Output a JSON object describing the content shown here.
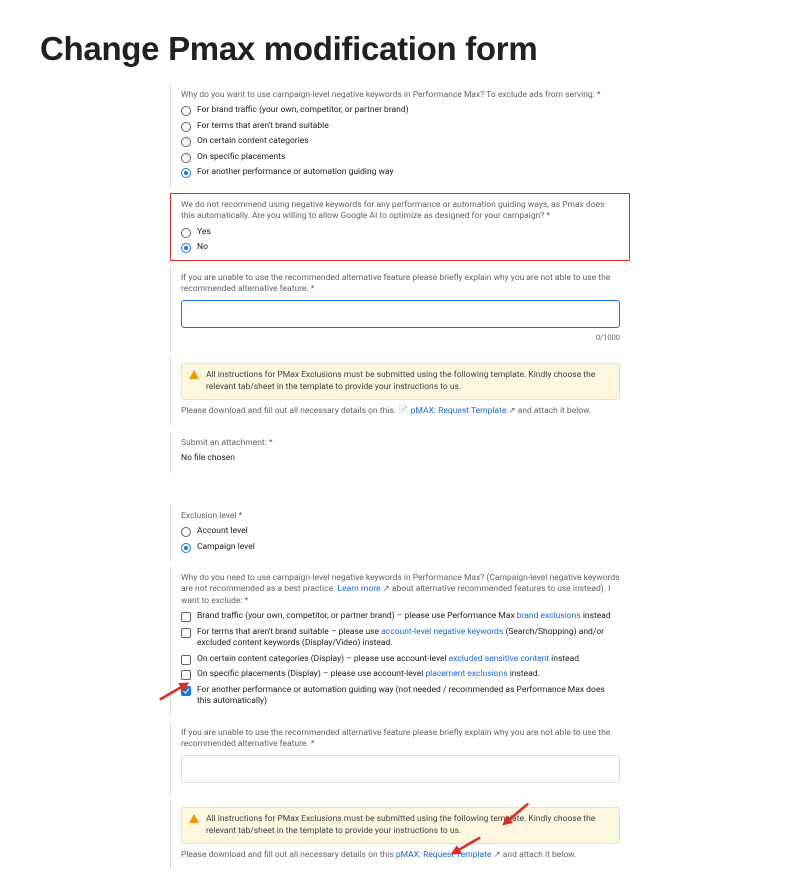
{
  "title": "Change Pmax modification form",
  "panel1": {
    "q1": {
      "text": "Why do you want to use campaign-level negative keywords in Performance Max? To exclude ads from serving: *",
      "opts": [
        "For brand traffic (your own, competitor, or partner brand)",
        "For terms that aren't brand suitable",
        "On certain content categories",
        "On specific placements",
        "For another performance or automation guiding way"
      ],
      "selected": 4
    },
    "warn": {
      "text": "We do not recommend using negative keywords for any performance or automation guiding ways, as Pmax does this automatically. Are you willing to allow Google AI to optimize as designed for your campaign? *",
      "opts": [
        "Yes",
        "No"
      ],
      "selected": 1
    },
    "explain": {
      "text": "If you are unable to use the recommended alternative feature please briefly explain why you are not able to use the recommended alternative feature. *",
      "counter": "0/1000"
    },
    "alert": "All instructions for PMax Exclusions must be submitted using the following template. Kindly choose the relevant tab/sheet in the template to provide your instructions to us.",
    "dl_pre": "Please download and fill out all necessary details on this. ",
    "dl_icon": "📄 ",
    "dl_link": "pMAX: Request Template",
    "dl_post": " ↗  and attach it below.",
    "submit_label": "Submit an attachment: *",
    "no_file": "No file chosen"
  },
  "panel2": {
    "excl": {
      "text": "Exclusion level *",
      "opts": [
        "Account level",
        "Campaign level"
      ],
      "selected": 1
    },
    "q2": {
      "pre": "Why do you need to use campaign-level negative keywords in Performance Max? (Campaign-level negative keywords are not recommended as a best practice. ",
      "learn": "Learn more",
      "post": " ↗  about alternative recommended features to use instead). I want to exclude: *",
      "items": [
        {
          "pre": "Brand traffic (your own, competitor, or partner brand) – please use Performance Max ",
          "link": "brand exclusions",
          "post": " instead"
        },
        {
          "pre": "For terms that aren't brand suitable – please use ",
          "link": "account-level negative keywords",
          "post": " (Search/Shopping) and/or excluded content keywords (Display/Video) instead."
        },
        {
          "pre": "On certain content categories (Display) – please use account-level ",
          "link": "excluded sensitive content",
          "post": " instead"
        },
        {
          "pre": "On specific placements (Display) – please use account-level ",
          "link": "placement exclusions",
          "post": " instead."
        },
        {
          "pre": "For another performance or automation guiding way (not needed / recommended as Performance Max does this automatically)",
          "link": "",
          "post": ""
        }
      ],
      "selected": 4
    },
    "explain2": "If you are unable to use the recommended alternative feature please briefly explain why you are not able to use the recommended alternative feature. *",
    "alert": "All instructions for PMax Exclusions must be submitted using the following template. Kindly choose the relevant tab/sheet in the template to provide your instructions to us.",
    "dl_pre": "Please download and fill out all necessary details on this ",
    "dl_link": "pMAX: Request Template",
    "dl_post": " ↗  and attach it below."
  }
}
